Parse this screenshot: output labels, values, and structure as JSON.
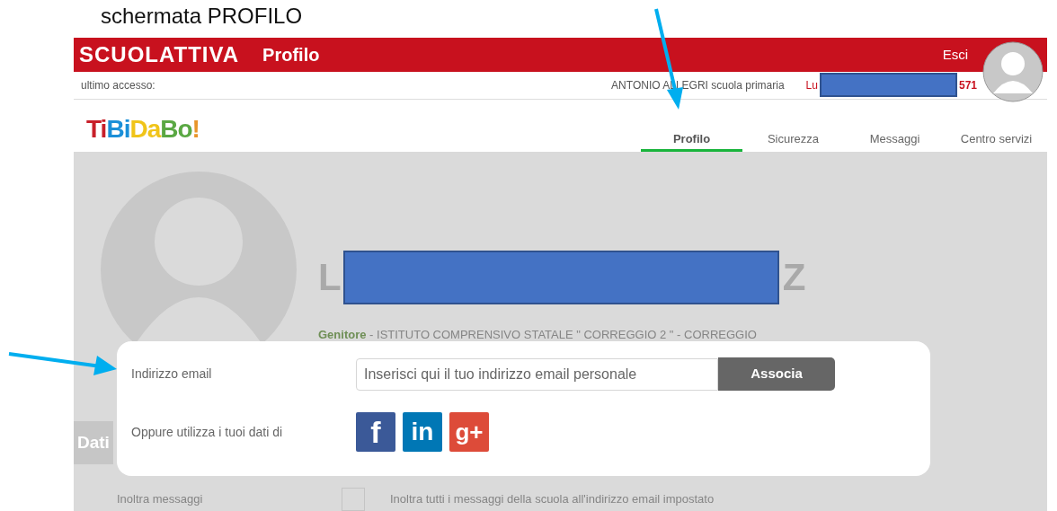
{
  "caption": "schermata PROFILO",
  "header": {
    "logo": "SCUOLATTIVA",
    "title": "Profilo",
    "logout": "Esci"
  },
  "info_bar": {
    "last_access_label": "ultimo accesso:",
    "school": "ANTONIO ALLEGRI scuola primaria",
    "user_prefix": "Lu",
    "user_suffix": "571"
  },
  "brand": "TiBiDaBo!",
  "tabs": [
    {
      "label": "Profilo",
      "selected": true
    },
    {
      "label": "Sicurezza",
      "selected": false
    },
    {
      "label": "Messaggi",
      "selected": false
    },
    {
      "label": "Centro servizi",
      "selected": false
    }
  ],
  "profile": {
    "name_start": "L",
    "name_end": "Z",
    "role": "Genitore",
    "institution": " - ISTITUTO COMPRENSIVO STATALE \" CORREGGIO 2 \" - CORREGGIO"
  },
  "section_label": "Dati",
  "settings": [
    {
      "label": "Inoltra messaggi",
      "checked": false,
      "description": "Inoltra tutti i messaggi della scuola all'indirizzo email impostato"
    }
  ],
  "dialog": {
    "email_label": "Indirizzo email",
    "email_placeholder": "Inserisci qui il tuo indirizzo email personale",
    "button": "Associa",
    "social_label": "Oppure utilizza i tuoi dati di",
    "social": [
      {
        "kind": "facebook",
        "glyph": "f"
      },
      {
        "kind": "linkedin",
        "glyph": "in"
      },
      {
        "kind": "google-plus",
        "glyph": "g+"
      }
    ]
  }
}
